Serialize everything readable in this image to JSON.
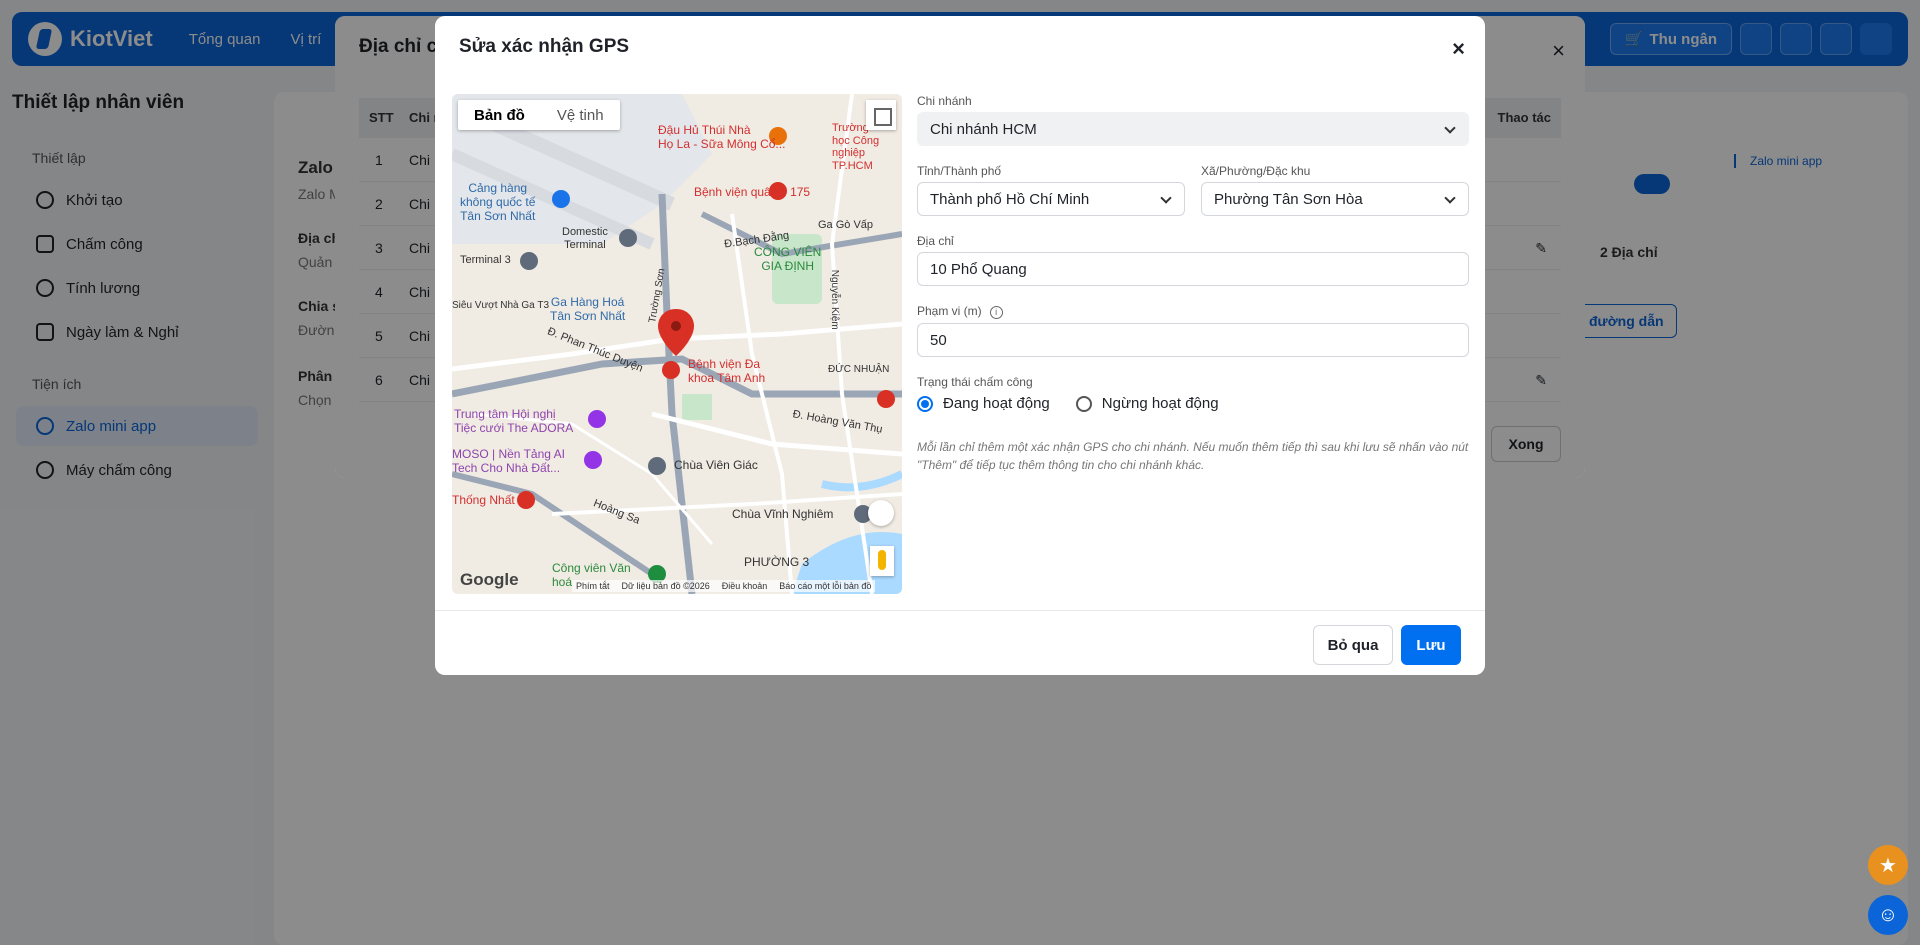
{
  "app": {
    "logo_text": "KiotViet",
    "nav": [
      "Tổng quan",
      "Vị trí"
    ],
    "cashier_label": "Thu ngân"
  },
  "page": {
    "title": "Thiết lập nhân viên"
  },
  "sidebar": {
    "group1": "Thiết lập",
    "items1": [
      {
        "label": "Khởi tạo",
        "icon": "gear-icon"
      },
      {
        "label": "Chấm công",
        "icon": "calendar-icon"
      },
      {
        "label": "Tính lương",
        "icon": "dollar-icon"
      },
      {
        "label": "Ngày làm & Nghỉ",
        "icon": "calendar-icon"
      }
    ],
    "group2": "Tiện ích",
    "items2": [
      {
        "label": "Zalo mini app",
        "icon": "user-icon",
        "active": true
      },
      {
        "label": "Máy chấm công",
        "icon": "fingerprint-icon"
      }
    ]
  },
  "behind": {
    "zalo_title": "Zalo",
    "zalo_sub": "Zalo M",
    "dia_chi": "Địa ch",
    "quan": "Quản",
    "chia": "Chia s",
    "duong": "Đườn",
    "phan": "Phân",
    "chon": "Chọn",
    "side_link": "Zalo mini app",
    "two_addresses": "2 Địa chỉ",
    "link_btn": "đường dẫn"
  },
  "under_dialog": {
    "title": "Địa chỉ ch",
    "col_stt": "STT",
    "col_branch": "Chi n",
    "col_action": "Thao tác",
    "rows": [
      {
        "stt": "1",
        "branch": "Chi"
      },
      {
        "stt": "2",
        "branch": "Chi"
      },
      {
        "stt": "3",
        "branch": "Chi"
      },
      {
        "stt": "4",
        "branch": "Chi"
      },
      {
        "stt": "5",
        "branch": "Chi"
      },
      {
        "stt": "6",
        "branch": "Chi"
      }
    ],
    "done_label": "Xong"
  },
  "dialog": {
    "title": "Sửa xác nhận GPS",
    "close": "×",
    "branch_label": "Chi nhánh",
    "branch_value": "Chi nhánh HCM",
    "city_label": "Tỉnh/Thành phố",
    "city_value": "Thành phố Hồ Chí Minh",
    "ward_label": "Xã/Phường/Đặc khu",
    "ward_value": "Phường Tân Sơn Hòa",
    "address_label": "Địa chỉ",
    "address_value": "10 Phổ Quang",
    "range_label": "Phạm vi (m)",
    "range_value": "50",
    "status_label": "Trạng thái chấm công",
    "status_active": "Đang hoạt động",
    "status_inactive": "Ngừng hoạt động",
    "note": "Mỗi lần chỉ thêm một xác nhận GPS cho chi nhánh. Nếu muốn thêm tiếp thì sau khi lưu sẽ nhấn vào nút \"Thêm\" để tiếp tục thêm thông tin cho chi nhánh khác.",
    "cancel_label": "Bỏ qua",
    "save_label": "Lưu"
  },
  "map": {
    "tab_map": "Bản đồ",
    "tab_sat": "Vệ tinh",
    "google": "Google",
    "attr": [
      "Phím tắt",
      "Dữ liệu bản đồ ©2026",
      "Điều khoản",
      "Báo cáo một lỗi bản đồ"
    ],
    "labels": {
      "l1": "Đậu Hủ Thúi Nhà",
      "l1b": "Họ La - Sữa Mông Cổ...",
      "l2": "Trường",
      "l2b": "học Công",
      "l2c": "nghiệp",
      "l2d": "TP.HCM",
      "l3": "Cảng hàng",
      "l3b": "không quốc tế",
      "l3c": "Tân Sơn Nhất",
      "l4": "Bệnh viện quân y 175",
      "l5": "Domestic",
      "l5b": "Terminal",
      "l6": "Terminal 3",
      "l7": "Đ.Bạch Đằng",
      "l8": "Ga Gò Vấp",
      "l9": "CÔNG VIÊN",
      "l9b": "GIA ĐỊNH",
      "l10": "Siêu Vượt Nhà Ga T3",
      "l11": "Ga Hàng Hoá",
      "l11b": "Tân Sơn Nhất",
      "l12": "Đ. Phan Thúc Duyện",
      "l13": "Bệnh viện Đa",
      "l13b": "khoa Tâm Anh",
      "l14": "ĐỨC NHUẬN",
      "l15": "Trung tâm Hội nghị",
      "l15b": "Tiệc cưới The ADORA",
      "l16": "MOSO | Nền Tảng AI",
      "l16b": "Tech Cho Nhà Đất...",
      "l17": "Chùa Viên Giác",
      "l18": "Đ. Hoàng Văn Thụ",
      "l19": "Thống Nhất",
      "l20": "Hoàng Sa",
      "l21": "Chùa Vĩnh Nghiêm",
      "l22": "PHƯỜNG 3",
      "l23": "Công viên Văn",
      "l23b": "hoá",
      "l24": "Nguyễn Kiệm",
      "l25": "Trường Sơn"
    }
  },
  "colors": {
    "brand": "#0b64d8",
    "primary_button": "#0070f0",
    "marker": "#d93025"
  }
}
